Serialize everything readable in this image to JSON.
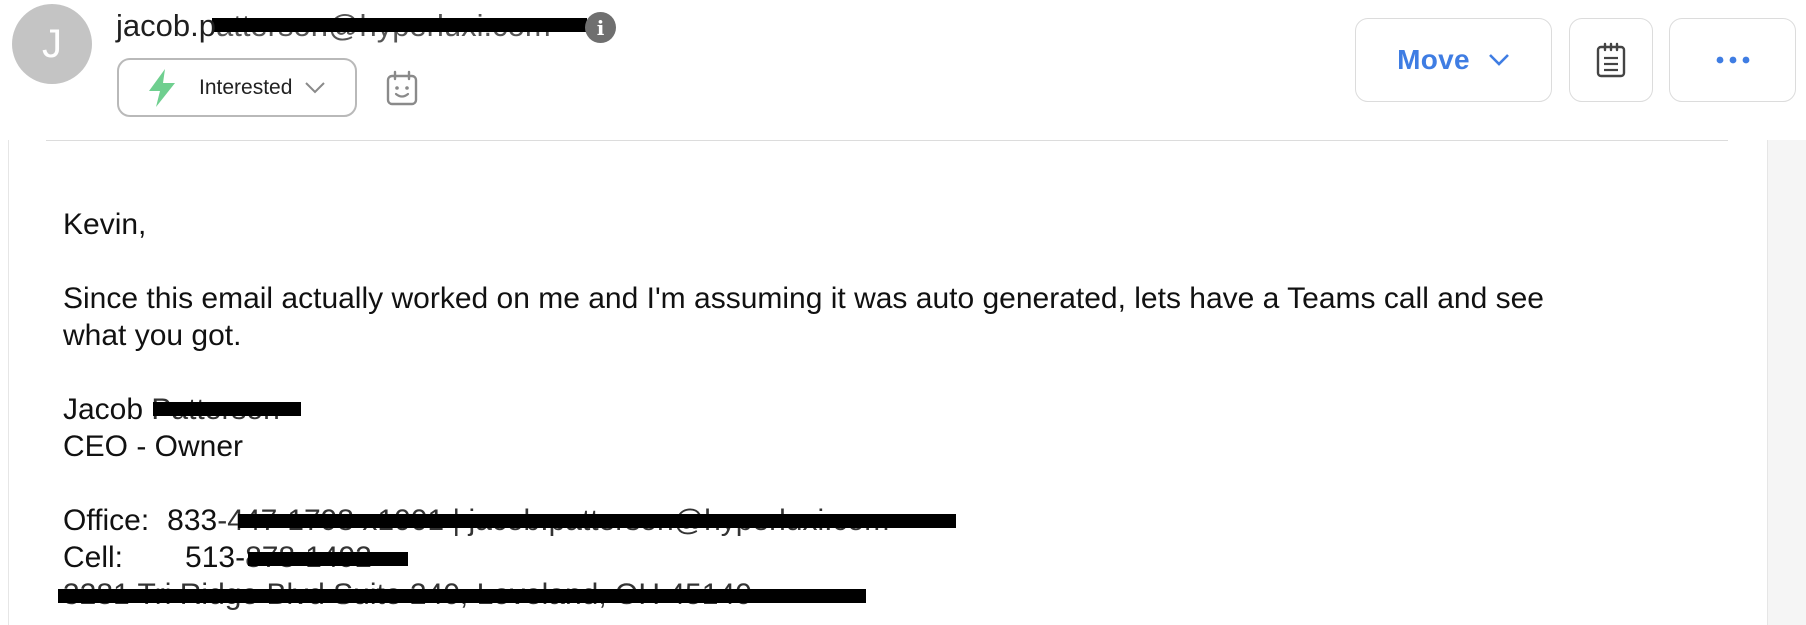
{
  "header": {
    "avatar_letter": "J",
    "sender_visible": "jacob.p",
    "sender_hidden": "atterson@hyperluxi.com",
    "status_label": "Interested",
    "move_label": "Move"
  },
  "icons": {
    "info": "info-icon",
    "status": "lightning-bolt-icon",
    "calendar": "calendar-face-icon",
    "notes": "notepad-icon",
    "more": "more-dots-icon"
  },
  "colors": {
    "accent": "#3f7de3",
    "bolt": "#6fcf8f",
    "avatar_bg": "#c4c4c4"
  },
  "email": {
    "greeting": "Kevin,",
    "body_line1": "Since this email actually worked on me and I'm assuming it was auto generated, lets have a Teams call and see",
    "body_line2": "what you got.",
    "sig_first": "Jacob",
    "sig_last": " Patterson",
    "sig_title": "CEO - Owner",
    "office_label": "Office:",
    "office_prefix": "833",
    "office_rest": "-447-1798 x1001 | jacob.patterson@hyperluxi.com",
    "cell_label": "Cell:",
    "cell_prefix": "513-",
    "cell_rest": "878-1492",
    "address": "3281 Tri Ridge Blvd Suite 240, Loveland, OH 45140"
  }
}
